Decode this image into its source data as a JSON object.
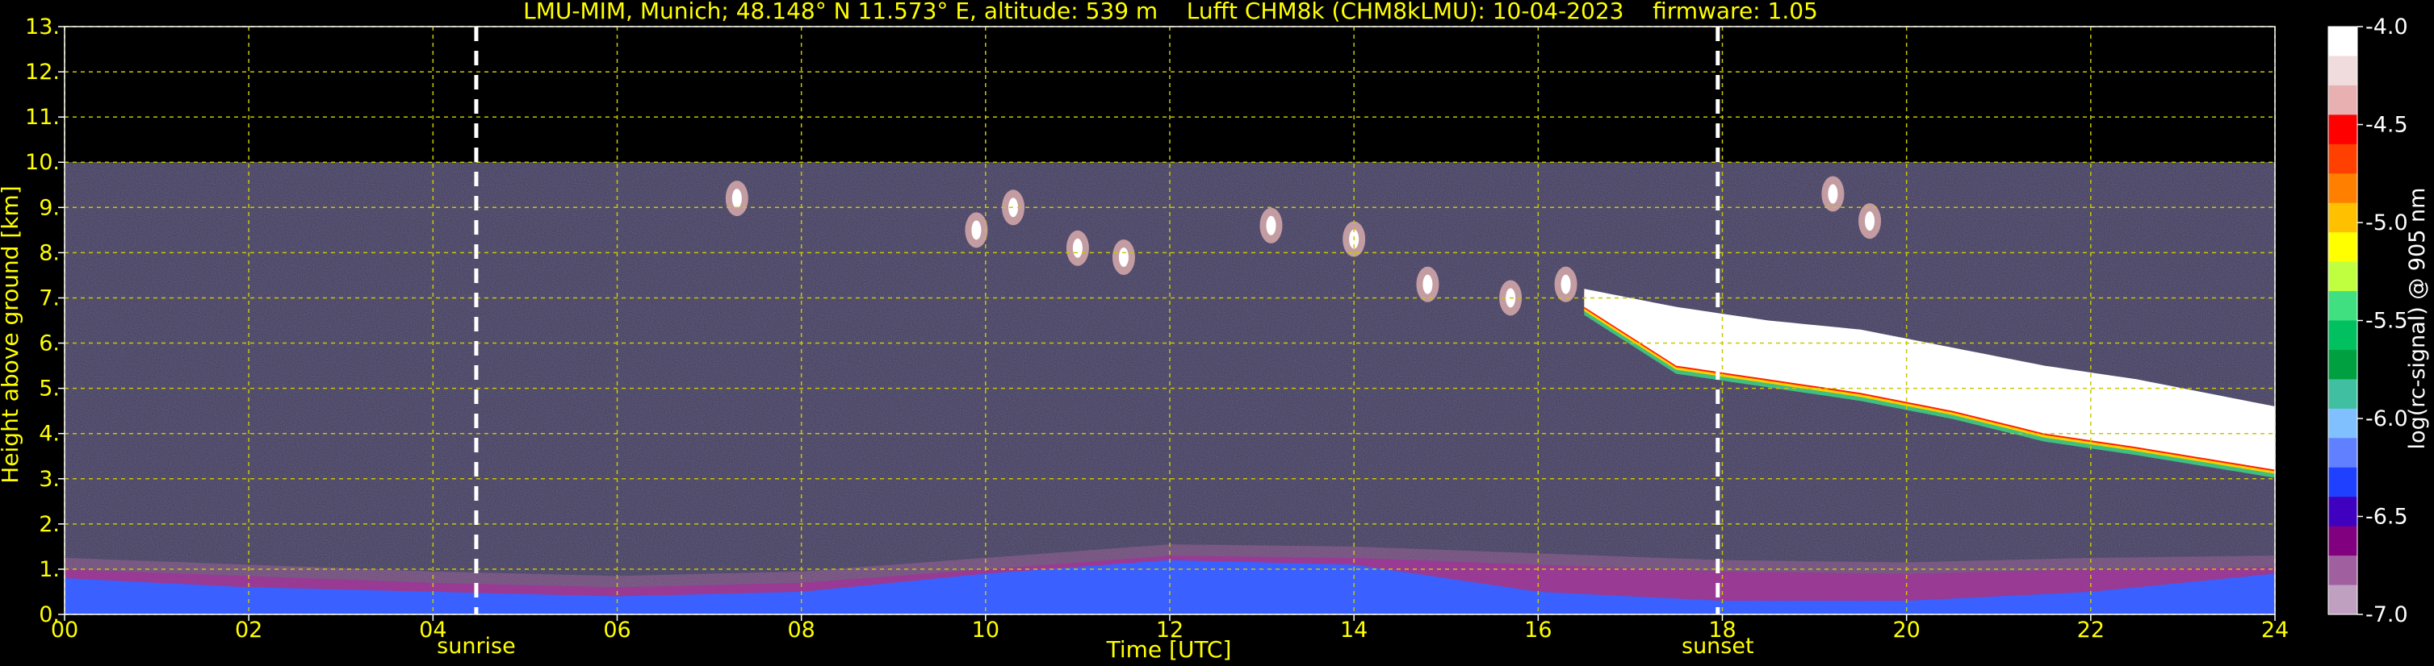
{
  "chart_data": {
    "type": "heatmap",
    "title": "LMU-MIM, Munich; 48.148° N 11.573° E, altitude: 539 m    Lufft CHM8k (CHM8kLMU): 10-04-2023    firmware: 1.05",
    "xlabel": "Time [UTC]",
    "ylabel": "Height above ground [km]",
    "xlim": [
      0,
      24
    ],
    "ylim": [
      0,
      13
    ],
    "x_tick_labels": [
      "00",
      "02",
      "04",
      "06",
      "08",
      "10",
      "12",
      "14",
      "16",
      "18",
      "20",
      "22",
      "24"
    ],
    "y_tick_labels": [
      "0.",
      "1.",
      "2.",
      "3.",
      "4.",
      "5.",
      "6.",
      "7.",
      "8.",
      "9.",
      "10.",
      "11.",
      "12.",
      "13."
    ],
    "grid": true,
    "data_ceiling_km": 10,
    "markers": [
      {
        "label": "sunrise",
        "x": 4.47
      },
      {
        "label": "sunset",
        "x": 17.95
      }
    ],
    "colorbar": {
      "label": "log(rc-signal) @ 905 nm",
      "range": [
        -7.0,
        -4.0
      ],
      "tick_labels": [
        "-4.0",
        "-4.5",
        "-5.0",
        "-5.5",
        "-6.0",
        "-6.5",
        "-7.0"
      ],
      "colors": [
        "#ffffff",
        "#f0dcdc",
        "#e8b0b0",
        "#ff0000",
        "#ff4000",
        "#ff8000",
        "#ffc000",
        "#ffff00",
        "#c0ff40",
        "#40e080",
        "#00c060",
        "#00a040",
        "#40c0a0",
        "#80c0ff",
        "#6080ff",
        "#2040ff",
        "#4000c0",
        "#800080",
        "#a060a0",
        "#c0a0c0"
      ]
    },
    "layers": {
      "boundary_layer": {
        "time": [
          0,
          2,
          4,
          6,
          8,
          10,
          12,
          14,
          16,
          18,
          20,
          22,
          24
        ],
        "top_km": [
          1.0,
          0.85,
          0.7,
          0.6,
          0.7,
          1.0,
          1.3,
          1.25,
          1.1,
          0.95,
          0.9,
          1.0,
          1.05
        ],
        "blue_top_km": [
          0.8,
          0.6,
          0.5,
          0.4,
          0.5,
          0.9,
          1.2,
          1.1,
          0.5,
          0.3,
          0.3,
          0.5,
          0.9
        ]
      },
      "cloud_band": {
        "time": [
          16.5,
          17.5,
          18.5,
          19.5,
          20.5,
          21.5,
          22.5,
          24
        ],
        "top_km": [
          7.2,
          6.8,
          6.5,
          6.3,
          5.9,
          5.5,
          5.2,
          4.6
        ],
        "bottom_km": [
          6.8,
          5.5,
          5.2,
          4.9,
          4.5,
          4.0,
          3.7,
          3.2
        ]
      },
      "cirrus_patches": [
        {
          "t": 7.3,
          "h": 9.2
        },
        {
          "t": 9.9,
          "h": 8.5
        },
        {
          "t": 10.3,
          "h": 9.0
        },
        {
          "t": 11.0,
          "h": 8.1
        },
        {
          "t": 11.5,
          "h": 7.9
        },
        {
          "t": 13.1,
          "h": 8.6
        },
        {
          "t": 14.0,
          "h": 8.3
        },
        {
          "t": 14.8,
          "h": 7.3
        },
        {
          "t": 15.7,
          "h": 7.0
        },
        {
          "t": 16.3,
          "h": 7.3
        },
        {
          "t": 19.2,
          "h": 9.3
        },
        {
          "t": 19.6,
          "h": 8.7
        }
      ]
    }
  }
}
